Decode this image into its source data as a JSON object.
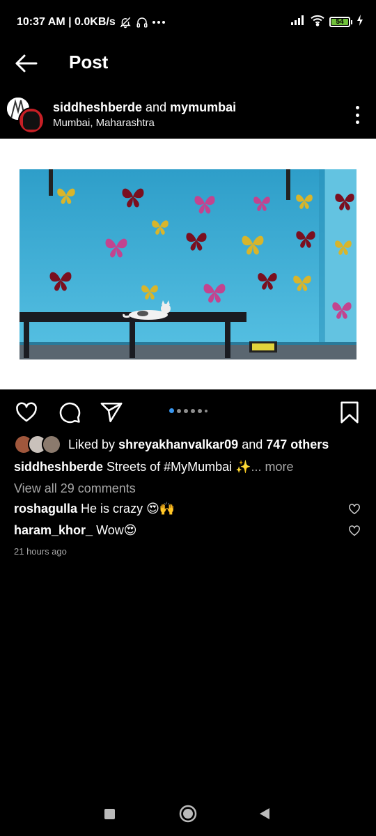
{
  "status": {
    "time_speed": "10:37 AM | 0.0KB/s",
    "battery_level": "54",
    "icons": [
      "bell-off-icon",
      "headphones-icon",
      "more-dots-icon",
      "signal-icon",
      "wifi-icon",
      "battery-icon",
      "charging-icon"
    ]
  },
  "header": {
    "title": "Post"
  },
  "post": {
    "author": "siddheshberde",
    "connector": "and",
    "coauthor": "mymumbai",
    "location": "Mumbai, Maharashtra",
    "carousel_count": 6,
    "carousel_active": 0
  },
  "likes": {
    "prefix": "Liked by",
    "user": "shreyakhanvalkar09",
    "connector": "and",
    "others": "747 others"
  },
  "caption": {
    "user": "siddheshberde",
    "text": "Streets of #MyMumbai ✨",
    "more": "... more"
  },
  "view_comments": "View all 29 comments",
  "comments": [
    {
      "user": "roshagulla",
      "text": "He is crazy 😍🙌"
    },
    {
      "user": "haram_khor_",
      "text": "Wow😍"
    }
  ],
  "timestamp": "21 hours ago",
  "colors": {
    "accent": "#3897f0",
    "wall": "#3fb1d8",
    "butterfly_red": "#7a0f1f",
    "butterfly_pink": "#c2448f",
    "butterfly_yellow": "#d8b52b"
  }
}
